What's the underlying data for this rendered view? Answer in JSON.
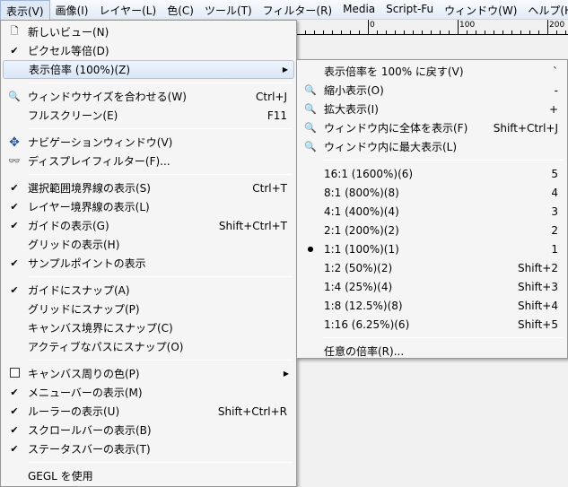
{
  "menubar": [
    "表示(V)",
    "画像(I)",
    "レイヤー(L)",
    "色(C)",
    "ツール(T)",
    "フィルター(R)",
    "Media",
    "Script-Fu",
    "ウィンドウ(W)",
    "ヘルプ(H)"
  ],
  "ruler": [
    "0",
    "100",
    "200"
  ],
  "main_menu": [
    {
      "label": "新しいビュー(N)",
      "icon": "page-icon"
    },
    {
      "label": "ピクセル等倍(D)",
      "icon": "check-icon"
    },
    {
      "label": "表示倍率 (100%)(Z)",
      "submenu": true,
      "highlighted": true
    },
    {
      "sep": true
    },
    {
      "label": "ウィンドウサイズを合わせる(W)",
      "icon": "zoom-icon",
      "shortcut": "Ctrl+J"
    },
    {
      "label": "フルスクリーン(E)",
      "shortcut": "F11"
    },
    {
      "sep": true
    },
    {
      "label": "ナビゲーションウィンドウ(V)",
      "icon": "move-icon"
    },
    {
      "label": "ディスプレイフィルター(F)...",
      "icon": "glasses-icon"
    },
    {
      "sep": true
    },
    {
      "label": "選択範囲境界線の表示(S)",
      "icon": "check-icon",
      "shortcut": "Ctrl+T"
    },
    {
      "label": "レイヤー境界線の表示(L)",
      "icon": "check-icon"
    },
    {
      "label": "ガイドの表示(G)",
      "icon": "check-icon",
      "shortcut": "Shift+Ctrl+T"
    },
    {
      "label": "グリッドの表示(H)"
    },
    {
      "label": "サンプルポイントの表示",
      "icon": "check-icon"
    },
    {
      "sep": true
    },
    {
      "label": "ガイドにスナップ(A)",
      "icon": "check-icon"
    },
    {
      "label": "グリッドにスナップ(P)"
    },
    {
      "label": "キャンバス境界にスナップ(C)"
    },
    {
      "label": "アクティブなパスにスナップ(O)"
    },
    {
      "sep": true
    },
    {
      "label": "キャンバス周りの色(P)",
      "icon": "color-swatch-icon",
      "submenu": true
    },
    {
      "label": "メニューバーの表示(M)",
      "icon": "check-icon"
    },
    {
      "label": "ルーラーの表示(U)",
      "icon": "check-icon",
      "shortcut": "Shift+Ctrl+R"
    },
    {
      "label": "スクロールバーの表示(B)",
      "icon": "check-icon"
    },
    {
      "label": "ステータスバーの表示(T)",
      "icon": "check-icon"
    },
    {
      "sep": true
    },
    {
      "label": "GEGL を使用"
    }
  ],
  "zoom_menu": [
    {
      "label": "表示倍率を 100% に戻す(V)",
      "shortcut": "`"
    },
    {
      "label": "縮小表示(O)",
      "icon": "zoom-out-icon",
      "shortcut": "-"
    },
    {
      "label": "拡大表示(I)",
      "icon": "zoom-in-icon",
      "shortcut": "+"
    },
    {
      "label": "ウィンドウ内に全体を表示(F)",
      "icon": "zoom-fit-icon",
      "shortcut": "Shift+Ctrl+J"
    },
    {
      "label": "ウィンドウ内に最大表示(L)",
      "icon": "zoom-fill-icon"
    },
    {
      "sep": true
    },
    {
      "label": "16:1 (1600%)(6)",
      "shortcut": "5"
    },
    {
      "label": "8:1 (800%)(8)",
      "shortcut": "4"
    },
    {
      "label": "4:1 (400%)(4)",
      "shortcut": "3"
    },
    {
      "label": "2:1 (200%)(2)",
      "shortcut": "2"
    },
    {
      "label": "1:1 (100%)(1)",
      "icon": "radio-dot-icon",
      "shortcut": "1"
    },
    {
      "label": "1:2 (50%)(2)",
      "shortcut": "Shift+2"
    },
    {
      "label": "1:4 (25%)(4)",
      "shortcut": "Shift+3"
    },
    {
      "label": "1:8 (12.5%)(8)",
      "shortcut": "Shift+4"
    },
    {
      "label": "1:16 (6.25%)(6)",
      "shortcut": "Shift+5"
    },
    {
      "sep": true
    },
    {
      "label": "任意の倍率(R)..."
    }
  ]
}
